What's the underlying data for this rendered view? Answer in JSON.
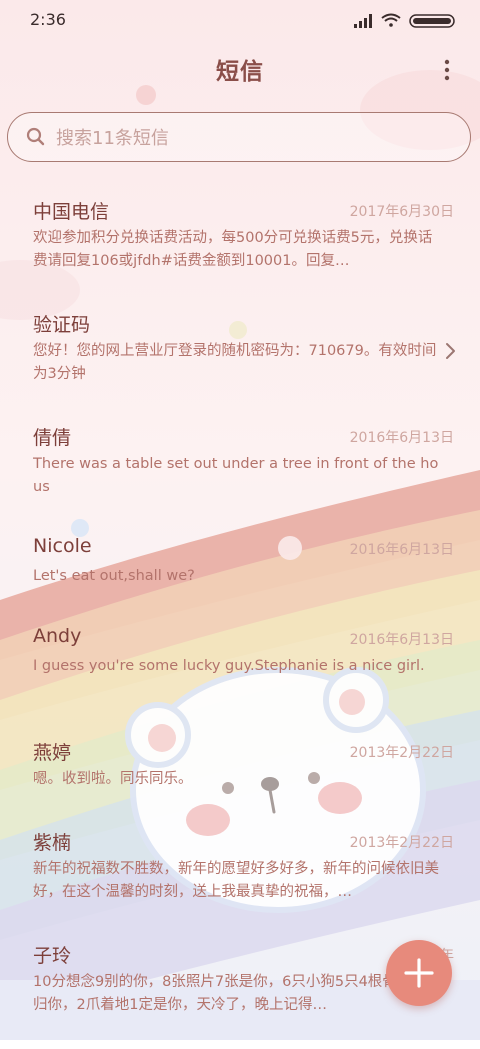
{
  "status_bar": {
    "time": "2:36"
  },
  "header": {
    "title": "短信"
  },
  "search": {
    "placeholder": "搜索11条短信"
  },
  "conversations": [
    {
      "name": "中国电信",
      "date": "2017年6月30日",
      "preview": "欢迎参加积分兑换话费活动，每500分可兑换话费5元，兑换话费请回复106或jfdh#话费金额到10001。回复…"
    },
    {
      "name": "验证码",
      "date": "",
      "preview": "您好！您的网上营业厅登录的随机密码为：710679。有效时间为3分钟"
    },
    {
      "name": "倩倩",
      "date": "2016年6月13日",
      "preview": "There was a table set out under a tree in front of the hous"
    },
    {
      "name": "Nicole",
      "date": "2016年6月13日",
      "preview": "Let's eat out,shall we?"
    },
    {
      "name": "Andy",
      "date": "2016年6月13日",
      "preview": "I guess you're some lucky guy.Stephanie is a nice girl."
    },
    {
      "name": "燕婷",
      "date": "2013年2月22日",
      "preview": "嗯。收到啦。同乐同乐。"
    },
    {
      "name": "紫楠",
      "date": "2013年2月22日",
      "preview": "新年的祝福数不胜数，新年的愿望好多好多，新年的问候依旧美好，在这个温馨的时刻，送上我最真挚的祝福，…"
    },
    {
      "name": "子玲",
      "date": "2013年",
      "preview": "10分想念9别的你，8张照片7张是你，6只小狗5只4根骨头3根归你，2爪着地1定是你，天冷了，晚上记得…"
    }
  ],
  "colors": {
    "accent": "#e78a7c",
    "title": "#8a4e49"
  },
  "icons": {
    "menu": "more-vertical-icon",
    "search": "search-icon",
    "compose": "plus-icon"
  }
}
